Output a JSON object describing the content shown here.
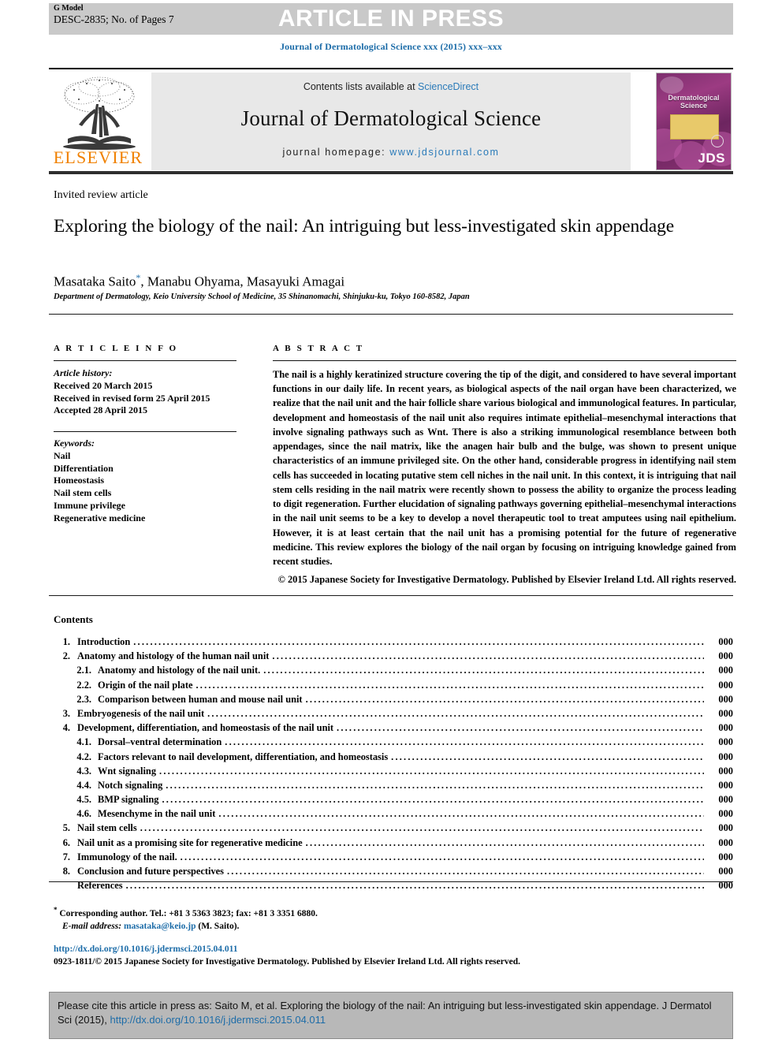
{
  "header": {
    "g_model_label": "G Model",
    "manuscript_id": "DESC-2835; No. of Pages 7",
    "press_banner": "ARTICLE IN PRESS",
    "journal_reference": "Journal of Dermatological Science xxx (2015) xxx–xxx"
  },
  "masthead": {
    "publisher_wordmark": "ELSEVIER",
    "contents_prefix": "Contents lists available at ",
    "contents_link": "ScienceDirect",
    "journal_title": "Journal of Dermatological Science",
    "homepage_prefix": "journal homepage: ",
    "homepage_url": "www.jdsjournal.com",
    "cover": {
      "title_line1": "Dermatological",
      "title_line2": "Science",
      "abbrev": "JDS"
    }
  },
  "article": {
    "kind": "Invited review article",
    "title": "Exploring the biology of the nail: An intriguing but less-investigated skin appendage",
    "authors": "Masataka Saito",
    "authors_rest": ", Manabu Ohyama, Masayuki Amagai",
    "corresponding_marker": "*",
    "affiliation": "Department of Dermatology, Keio University School of Medicine, 35 Shinanomachi, Shinjuku-ku, Tokyo 160-8582, Japan"
  },
  "article_info": {
    "heading": "A R T I C L E   I N F O",
    "history_label": "Article history:",
    "history": [
      "Received 20 March 2015",
      "Received in revised form 25 April 2015",
      "Accepted 28 April 2015"
    ],
    "keywords_label": "Keywords:",
    "keywords": [
      "Nail",
      "Differentiation",
      "Homeostasis",
      "Nail stem cells",
      "Immune privilege",
      "Regenerative medicine"
    ]
  },
  "abstract": {
    "heading": "A B S T R A C T",
    "body": "The nail is a highly keratinized structure covering the tip of the digit, and considered to have several important functions in our daily life. In recent years, as biological aspects of the nail organ have been characterized, we realize that the nail unit and the hair follicle share various biological and immunological features. In particular, development and homeostasis of the nail unit also requires intimate epithelial–mesenchymal interactions that involve signaling pathways such as Wnt. There is also a striking immunological resemblance between both appendages, since the nail matrix, like the anagen hair bulb and the bulge, was shown to present unique characteristics of an immune privileged site. On the other hand, considerable progress in identifying nail stem cells has succeeded in locating putative stem cell niches in the nail unit. In this context, it is intriguing that nail stem cells residing in the nail matrix were recently shown to possess the ability to organize the process leading to digit regeneration. Further elucidation of signaling pathways governing epithelial–mesenchymal interactions in the nail unit seems to be a key to develop a novel therapeutic tool to treat amputees using nail epithelium. However, it is at least certain that the nail unit has a promising potential for the future of regenerative medicine. This review explores the biology of the nail organ by focusing on intriguing knowledge gained from recent studies.",
    "copyright": "© 2015 Japanese Society for Investigative Dermatology. Published by Elsevier Ireland Ltd. All rights reserved."
  },
  "contents": {
    "heading": "Contents",
    "entries": [
      {
        "num": "1.",
        "label": "Introduction",
        "page": "000",
        "sub": false
      },
      {
        "num": "2.",
        "label": "Anatomy and histology of the human nail unit",
        "page": "000",
        "sub": false
      },
      {
        "num": "2.1.",
        "label": "Anatomy and histology of the nail unit.",
        "page": "000",
        "sub": true
      },
      {
        "num": "2.2.",
        "label": "Origin of the nail plate",
        "page": "000",
        "sub": true
      },
      {
        "num": "2.3.",
        "label": "Comparison between human and mouse nail unit",
        "page": "000",
        "sub": true
      },
      {
        "num": "3.",
        "label": "Embryogenesis of the nail unit",
        "page": "000",
        "sub": false
      },
      {
        "num": "4.",
        "label": "Development, differentiation, and homeostasis of the nail unit",
        "page": "000",
        "sub": false
      },
      {
        "num": "4.1.",
        "label": "Dorsal–ventral determination",
        "page": "000",
        "sub": true
      },
      {
        "num": "4.2.",
        "label": "Factors relevant to nail development, differentiation, and homeostasis",
        "page": "000",
        "sub": true
      },
      {
        "num": "4.3.",
        "label": "Wnt signaling",
        "page": "000",
        "sub": true
      },
      {
        "num": "4.4.",
        "label": "Notch signaling",
        "page": "000",
        "sub": true
      },
      {
        "num": "4.5.",
        "label": "BMP signaling",
        "page": "000",
        "sub": true
      },
      {
        "num": "4.6.",
        "label": "Mesenchyme in the nail unit",
        "page": "000",
        "sub": true
      },
      {
        "num": "5.",
        "label": "Nail stem cells",
        "page": "000",
        "sub": false
      },
      {
        "num": "6.",
        "label": "Nail unit as a promising site for regenerative medicine",
        "page": "000",
        "sub": false
      },
      {
        "num": "7.",
        "label": "Immunology of the nail.",
        "page": "000",
        "sub": false
      },
      {
        "num": "8.",
        "label": "Conclusion and future perspectives",
        "page": "000",
        "sub": false
      },
      {
        "num": "",
        "label": "References",
        "page": "000",
        "sub": false
      }
    ]
  },
  "footnotes": {
    "corresponding": "Corresponding author. Tel.: +81 3 5363 3823; fax: +81 3 3351 6880.",
    "email_label": "E-mail address:",
    "email": "masataka@keio.jp",
    "email_suffix": " (M. Saito).",
    "doi_url": "http://dx.doi.org/10.1016/j.jdermsci.2015.04.011",
    "issn_line": "0923-1811/© 2015 Japanese Society for Investigative Dermatology. Published by Elsevier Ireland Ltd. All rights reserved."
  },
  "cite_box": {
    "text": "Please cite this article in press as: Saito M, et al. Exploring the biology of the nail: An intriguing but less-investigated skin appendage. J Dermatol Sci (2015), ",
    "link": "http://dx.doi.org/10.1016/j.jdermsci.2015.04.011"
  },
  "colors": {
    "link_blue": "#1c6ca8",
    "elsevier_orange": "#f08000",
    "banner_gray": "#c9c9c9",
    "masthead_gray": "#e8e8e8",
    "cite_box_gray": "#b8b8b8"
  }
}
